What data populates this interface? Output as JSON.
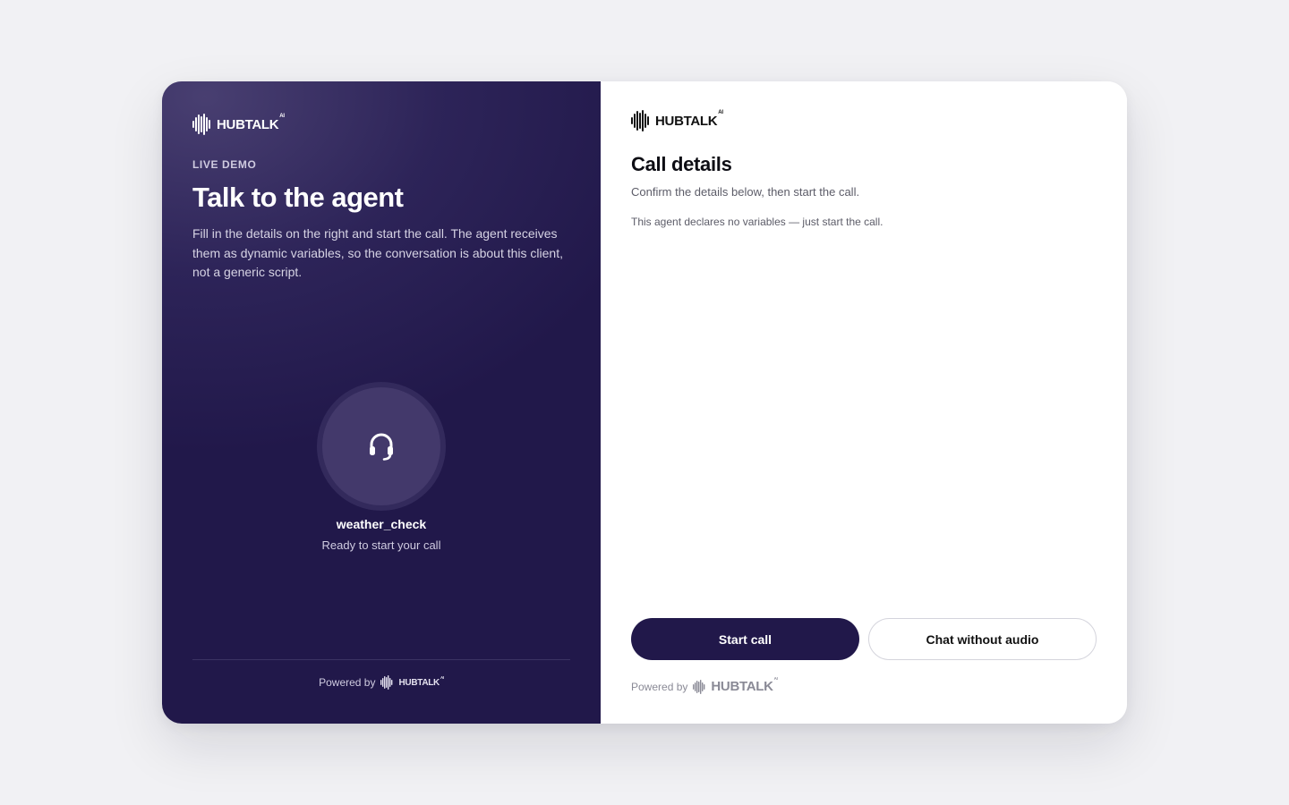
{
  "brand": {
    "name": "HUBTALK",
    "suffix": "AI",
    "powered_by": "Powered by"
  },
  "left_panel": {
    "eyebrow": "LIVE DEMO",
    "headline": "Talk to the agent",
    "intro": "Fill in the details on the right and start the call. The agent receives them as dynamic variables, so the conversation is about this client, not a generic script.",
    "agent": {
      "name": "weather_check",
      "status": "Ready to start your call",
      "icon": "headset-icon"
    }
  },
  "right_panel": {
    "title": "Call details",
    "subtitle": "Confirm the details below, then start the call.",
    "note": "This agent declares no variables — just start the call.",
    "primary_button": "Start call",
    "secondary_button": "Chat without audio"
  },
  "colors": {
    "page_background": "#f1f1f4",
    "brand_dark": "#21184a",
    "avatar_fill": "#43396b",
    "panel_white": "#ffffff"
  }
}
